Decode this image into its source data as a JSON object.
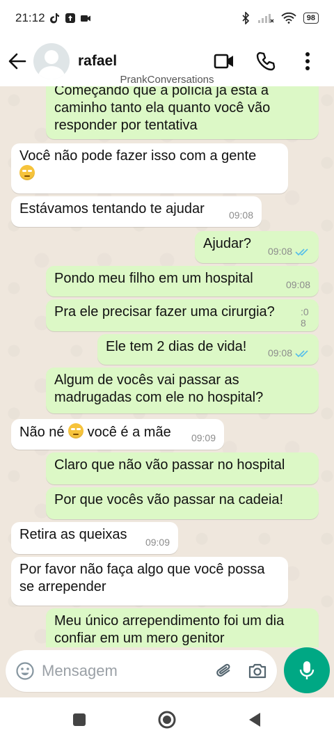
{
  "status_bar": {
    "time": "21:12",
    "battery": "98"
  },
  "header": {
    "contact_name": "rafael"
  },
  "watermark": "PrankConversations",
  "messages": [
    {
      "dir": "out",
      "lines": [
        "Começando que a polícia já está a",
        "caminho tanto ela quanto você vão",
        "responder por tentativa"
      ],
      "time": ""
    },
    {
      "dir": "in",
      "lines": [
        "Você não pode fazer isso com a gente"
      ],
      "emoji": true,
      "time": ""
    },
    {
      "dir": "in",
      "lines": [
        "Estávamos tentando te ajudar"
      ],
      "time": "09:08"
    },
    {
      "dir": "out",
      "lines": [
        "Ajudar?"
      ],
      "time": "09:08",
      "read": true
    },
    {
      "dir": "out",
      "lines": [
        "Pondo meu filho em um hospital"
      ],
      "time": "09:08"
    },
    {
      "dir": "out",
      "lines": [
        "Pra ele precisar fazer uma cirurgia?"
      ],
      "time": ":0\n8"
    },
    {
      "dir": "out",
      "lines": [
        "Ele tem 2 dias de vida!"
      ],
      "time": "09:08",
      "read": true
    },
    {
      "dir": "out",
      "lines": [
        "Algum de vocês vai passar as",
        "madrugadas com ele no hospital?"
      ],
      "time": ""
    },
    {
      "dir": "in",
      "lines": [
        "Não né",
        "você é a mãe"
      ],
      "time": "09:09"
    },
    {
      "dir": "out",
      "lines": [
        "Claro que não vão passar no hospital"
      ],
      "time": ""
    },
    {
      "dir": "out",
      "lines": [
        "Por que vocês vão passar na cadeia!"
      ],
      "time": ""
    },
    {
      "dir": "in",
      "lines": [
        "Retira as queixas"
      ],
      "time": "09:09"
    },
    {
      "dir": "in",
      "lines": [
        "Por favor não faça algo que você possa",
        "se arrepender"
      ],
      "time": ""
    },
    {
      "dir": "out",
      "lines": [
        "Meu único arrependimento foi um dia",
        "confiar em um mero genitor"
      ],
      "time": ""
    }
  ],
  "composer": {
    "placeholder": "Mensagem"
  },
  "colors": {
    "incoming": "#ffffff",
    "outgoing": "#dcf8c6",
    "accent": "#00a884",
    "read_tick": "#53bdeb"
  },
  "icons": [
    "back-arrow-icon",
    "video-call-icon",
    "phone-icon",
    "more-options-icon",
    "emoji-icon",
    "attach-icon",
    "camera-icon",
    "mic-icon"
  ]
}
